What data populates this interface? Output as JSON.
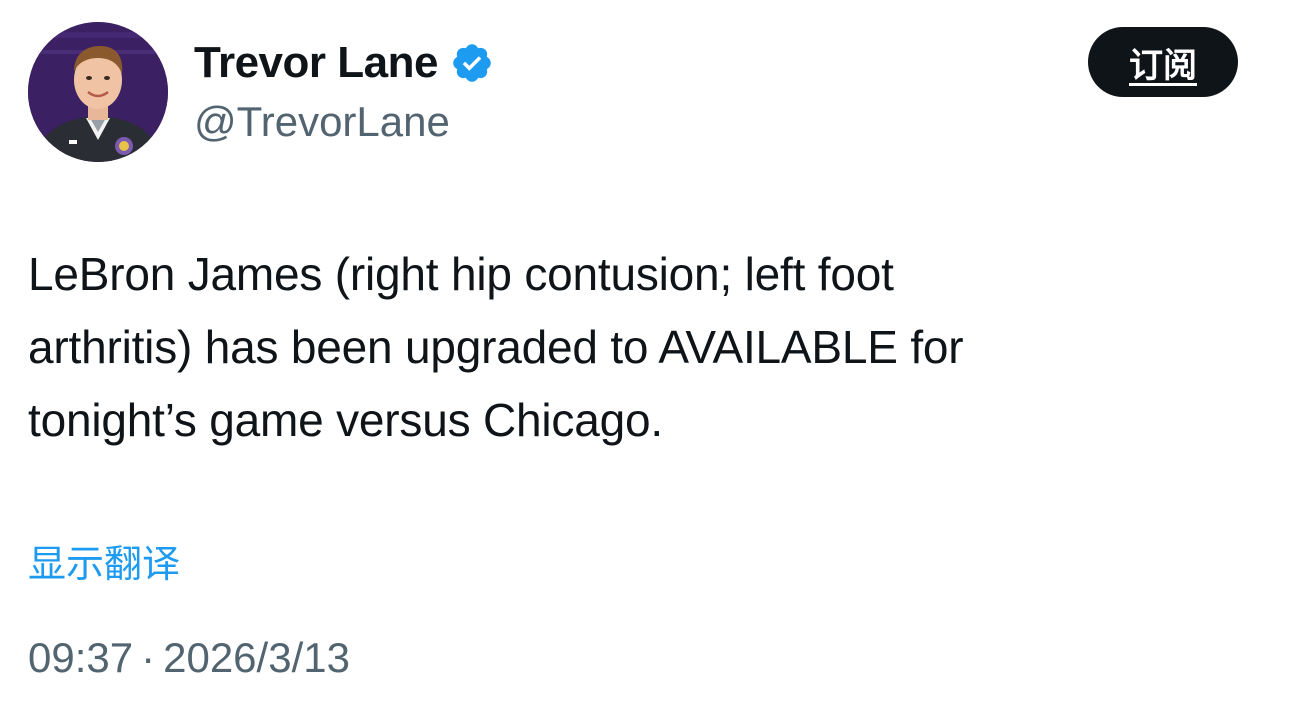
{
  "author": {
    "display_name": "Trevor Lane",
    "handle": "@TrevorLane",
    "verified": true
  },
  "subscribe_label": "订阅",
  "tweet": {
    "lines": [
      "LeBron James (right hip contusion; left foot",
      "arthritis) has been upgraded to AVAILABLE for",
      "tonight’s game versus Chicago."
    ]
  },
  "translate_label": "显示翻译",
  "meta": {
    "time": "09:37",
    "separator": "·",
    "date": "2026/3/13"
  },
  "colors": {
    "text": "#0f1419",
    "secondary": "#536471",
    "link": "#1d9bf0",
    "verified": "#1d9bf0",
    "button_bg": "#0f1419"
  },
  "icons": {
    "verified": "verified-badge-icon",
    "avatar": "profile-photo"
  }
}
